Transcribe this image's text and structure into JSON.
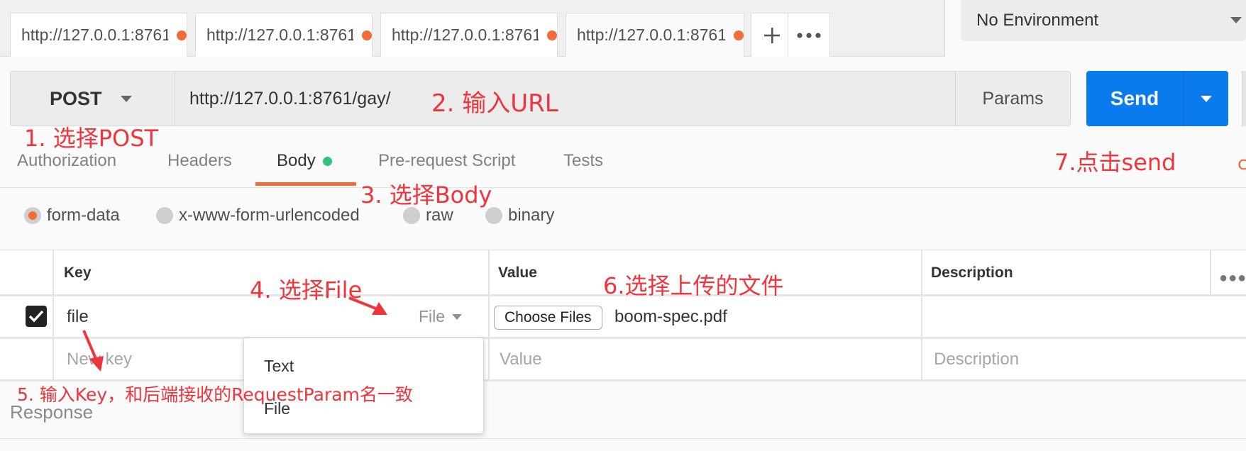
{
  "tabs": [
    {
      "url": "http://127.0.0.1:8761",
      "active": false
    },
    {
      "url": "http://127.0.0.1:8761",
      "active": false
    },
    {
      "url": "http://127.0.0.1:8761",
      "active": false
    },
    {
      "url": "http://127.0.0.1:8761",
      "active": true
    }
  ],
  "tab_actions": {
    "new_icon": "plus-icon",
    "more_icon": "more-dots-icon"
  },
  "environment": {
    "selected": "No Environment"
  },
  "request": {
    "method": "POST",
    "url": "http://127.0.0.1:8761/gay/",
    "params_label": "Params",
    "send_label": "Send"
  },
  "subtabs": [
    {
      "label": "Authorization"
    },
    {
      "label": "Headers"
    },
    {
      "label": "Body",
      "active": true
    },
    {
      "label": "Pre-request Script"
    },
    {
      "label": "Tests"
    }
  ],
  "body_types": [
    {
      "label": "form-data",
      "selected": true
    },
    {
      "label": "x-www-form-urlencoded",
      "selected": false
    },
    {
      "label": "raw",
      "selected": false
    },
    {
      "label": "binary",
      "selected": false
    }
  ],
  "table": {
    "headers": {
      "key": "Key",
      "value": "Value",
      "description": "Description"
    },
    "row": {
      "key": "file",
      "type": "File",
      "choose_label": "Choose Files",
      "file_name": "boom-spec.pdf",
      "checked": true
    },
    "new_row": {
      "key_placeholder": "New key",
      "value_placeholder": "Value",
      "description_placeholder": "Description"
    }
  },
  "type_dropdown": {
    "options": [
      "Text",
      "File"
    ]
  },
  "response_label": "Response",
  "annotations": {
    "step1": "1. 选择POST",
    "step2": "2. 输入URL",
    "step3": "3. 选择Body",
    "step4": "4. 选择File",
    "step5": "5. 输入Key，和后端接收的RequestParam名一致",
    "step6": "6.选择上传的文件",
    "step7": "7.点击send",
    "edge_char": "c"
  },
  "colors": {
    "accent": "#f26b3a",
    "send": "#097bed",
    "annotation": "#f0343c",
    "body_dot": "#33c37b"
  }
}
